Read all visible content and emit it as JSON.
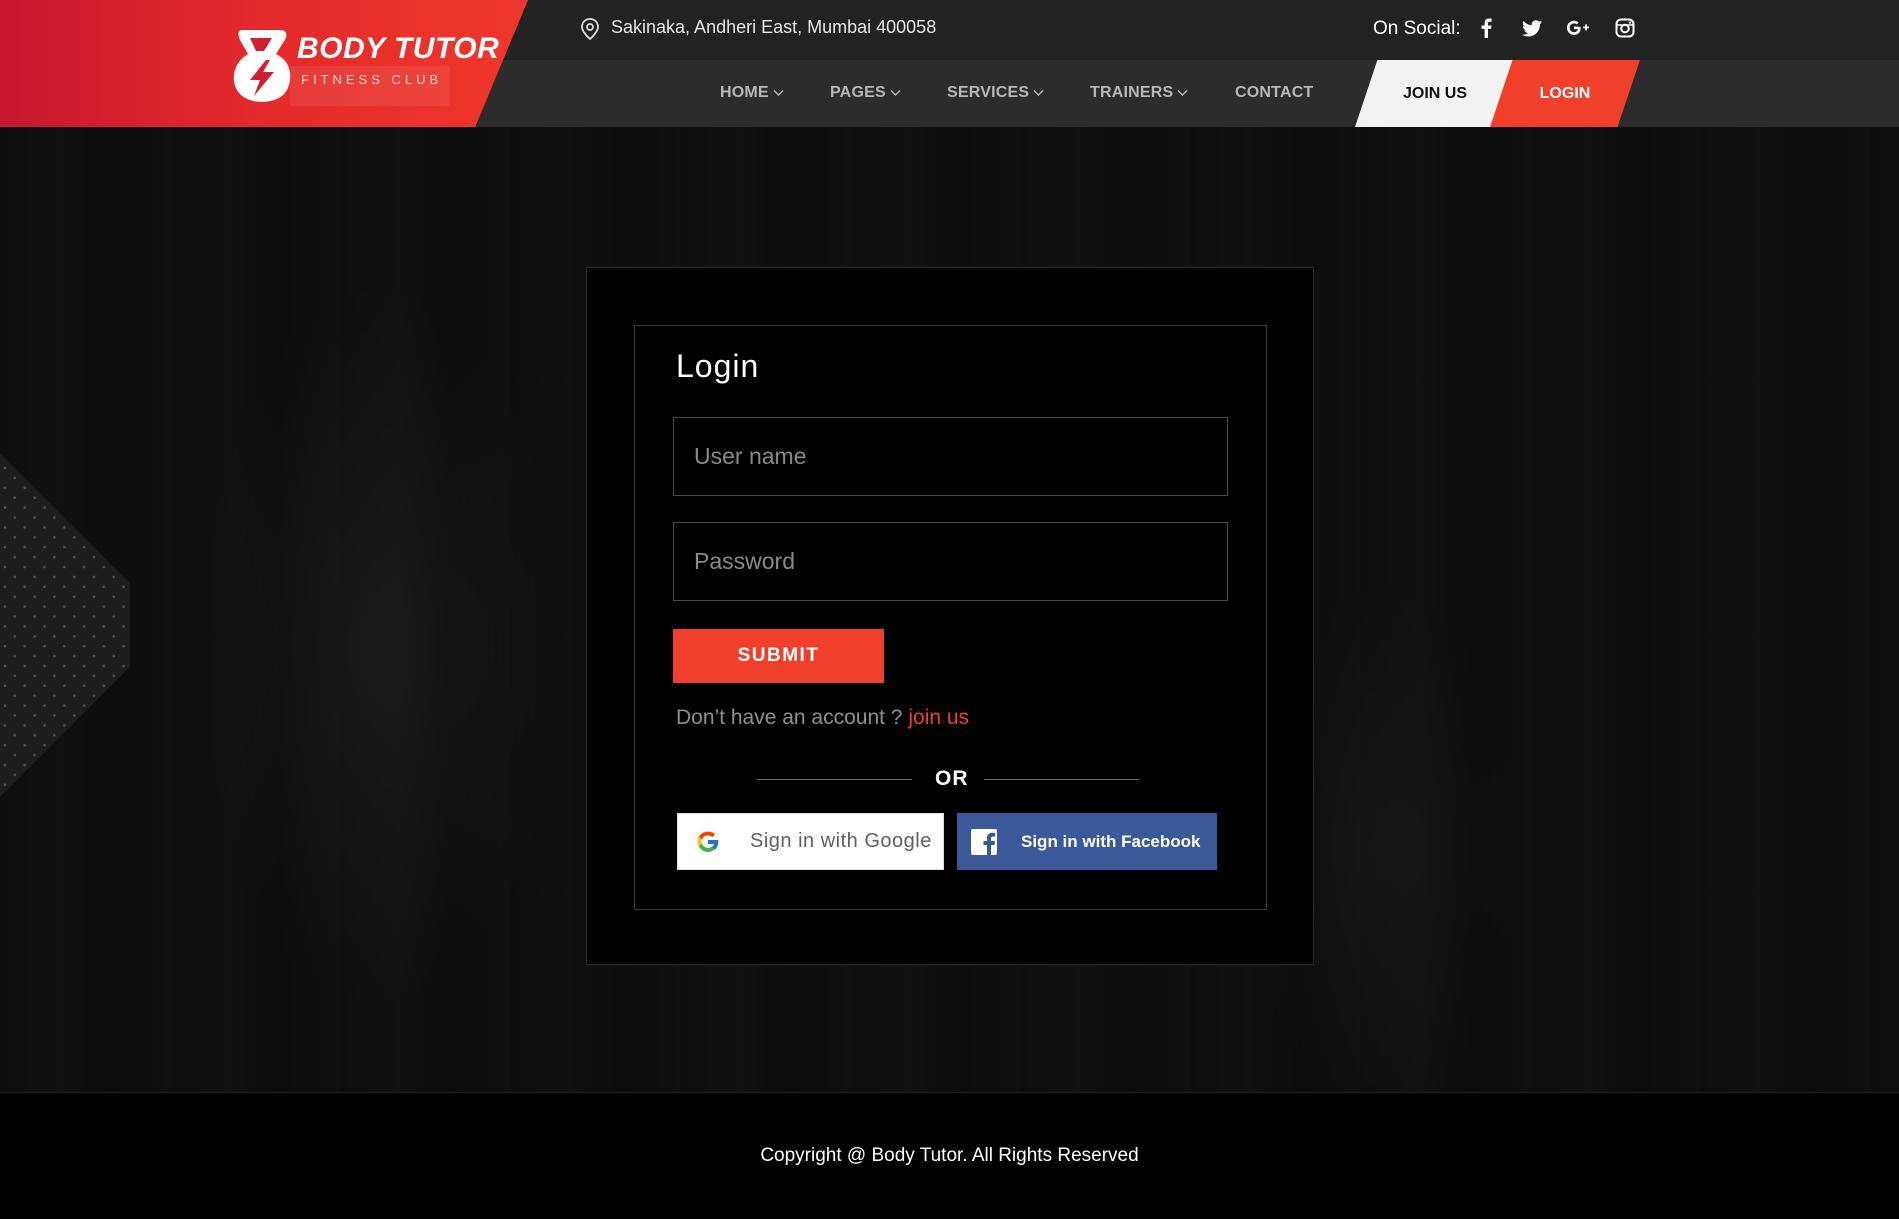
{
  "brand": {
    "name": "BODY TUTOR",
    "tagline": "FITNESS CLUB"
  },
  "topbar": {
    "address": "Sakinaka, Andheri East, Mumbai 400058",
    "social_label": "On Social:",
    "social_icons": [
      "facebook-icon",
      "twitter-icon",
      "google-plus-icon",
      "instagram-icon"
    ]
  },
  "nav": {
    "items": [
      {
        "label": "HOME",
        "dropdown": true
      },
      {
        "label": "PAGES",
        "dropdown": true
      },
      {
        "label": "SERVICES",
        "dropdown": true
      },
      {
        "label": "TRAINERS",
        "dropdown": true
      },
      {
        "label": "CONTACT",
        "dropdown": false
      }
    ],
    "join_label": "JOIN US",
    "login_label": "LOGIN"
  },
  "login": {
    "title": "Login",
    "username_placeholder": "User name",
    "password_placeholder": "Password",
    "submit_label": "SUBMIT",
    "account_prompt": "Don’t have an account ?",
    "join_link": "join us",
    "or_label": "OR",
    "google_label": "Sign in with Google",
    "facebook_label": "Sign in with Facebook"
  },
  "footer": {
    "copyright": "Copyright @ Body Tutor. All Rights Reserved"
  },
  "colors": {
    "accent": "#f0402b",
    "brand_red": "#c8182f",
    "facebook_blue": "#3b5998"
  }
}
